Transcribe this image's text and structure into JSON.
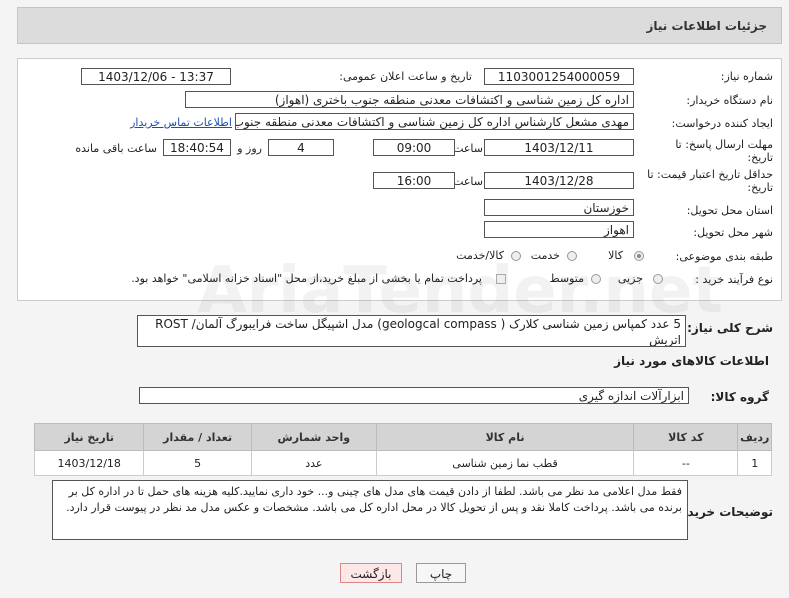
{
  "header": {
    "title": "جزئیات اطلاعات نیاز"
  },
  "form": {
    "need_number_label": "شماره نیاز:",
    "need_number": "1103001254000059",
    "announce_label": "تاریخ و ساعت اعلان عمومی:",
    "announce_value": "1403/12/06 - 13:37",
    "buyer_label": "نام دستگاه خریدار:",
    "buyer_value": "اداره کل زمین شناسی و اکتشافات معدنی منطقه جنوب باختری (اهواز)",
    "creator_label": "ایجاد کننده درخواست:",
    "creator_value": "مهدی مشعل کارشناس اداره کل زمین شناسی و اکتشافات معدنی منطقه جنوب",
    "contact_link": "اطلاعات تماس خریدار",
    "deadline_label_1": "مهلت ارسال پاسخ: تا",
    "deadline_label_2": "تاریخ:",
    "deadline_date": "1403/12/11",
    "time_label": "ساعت",
    "deadline_time": "09:00",
    "days_value": "4",
    "days_label": "روز و",
    "remaining_time": "18:40:54",
    "remaining_label": "ساعت باقی مانده",
    "validity_label_1": "حداقل تاریخ اعتبار قیمت: تا",
    "validity_label_2": "تاریخ:",
    "validity_date": "1403/12/28",
    "validity_time_label": "ساعت",
    "validity_time": "16:00",
    "province_label": "استان محل تحویل:",
    "province_value": "خوزستان",
    "city_label": "شهر محل تحویل:",
    "city_value": "اهواز",
    "category_label": "طبقه بندی موضوعی:",
    "category_options": [
      "کالا",
      "خدمت",
      "کالا/خدمت"
    ],
    "process_label": "نوع فرآیند خرید :",
    "process_options": [
      "جزیی",
      "متوسط"
    ],
    "payment_note": "پرداخت تمام یا بخشی از مبلغ خرید،از محل \"اسناد خزانه اسلامی\" خواهد بود."
  },
  "description": {
    "label": "شرح کلی نیاز:",
    "value": "5 عدد کمپاس زمین شناسی کلارک ( geologcal compass) مدل اشپیگل ساخت فرایبورگ آلمان/ ROST اتریش"
  },
  "goods": {
    "section_title": "اطلاعات کالاهای مورد نیاز",
    "group_label": "گروه کالا:",
    "group_value": "ابزارآلات اندازه گیری",
    "columns": [
      "ردیف",
      "کد کالا",
      "نام کالا",
      "واحد شمارش",
      "تعداد / مقدار",
      "تاریخ نیاز"
    ],
    "rows": [
      {
        "row": "1",
        "code": "--",
        "name": "قطب نما زمین شناسی",
        "unit": "عدد",
        "qty": "5",
        "date": "1403/12/18"
      }
    ]
  },
  "buyer_notes": {
    "label": "توضیحات خریدار:",
    "value": "فقط مدل اعلامی مد نظر می باشد. لطفا از دادن قیمت های مدل های چینی و... خود داری نمایید.کلیه هزینه های حمل تا در اداره کل بر برنده می باشد. پرداخت کاملا نقد و پس از تحویل کالا در محل اداره کل می باشد. مشخصات و عکس مدل مد نظر در پیوست قرار دارد."
  },
  "buttons": {
    "print": "چاپ",
    "back": "بازگشت"
  },
  "watermark": "AriaTender.net"
}
